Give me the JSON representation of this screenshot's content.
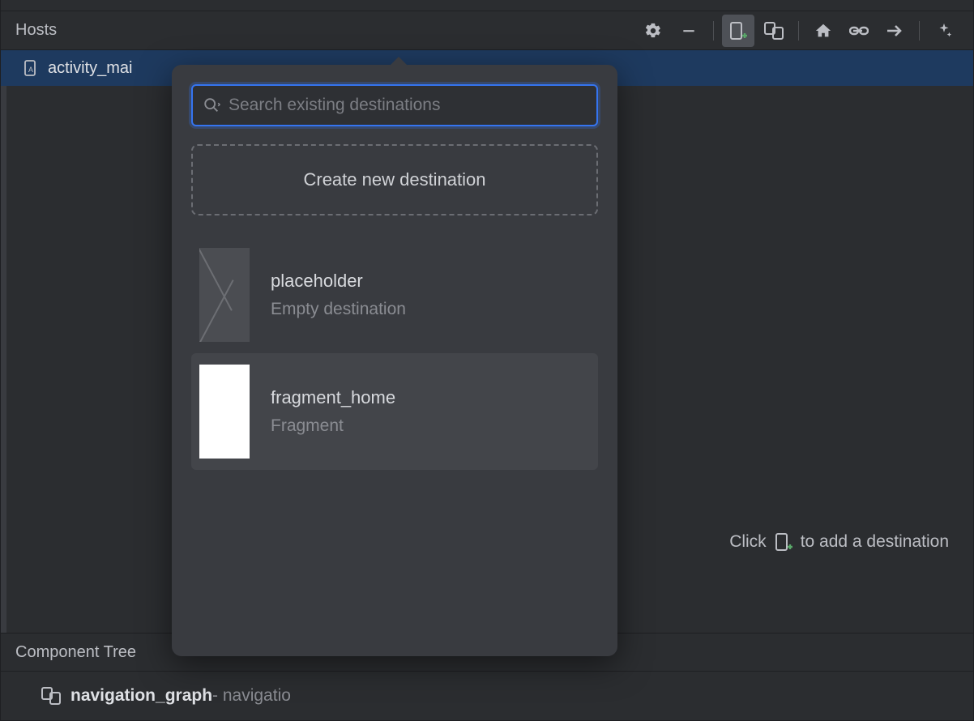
{
  "header": {
    "title": "Hosts"
  },
  "hosts": {
    "active_label": "activity_mai"
  },
  "hint": {
    "before": "Click",
    "after": "to add a destination"
  },
  "tree": {
    "header": "Component Tree",
    "item_name": "navigation_graph",
    "item_suffix": " - navigatio"
  },
  "popup": {
    "search_placeholder": "Search existing destinations",
    "create_label": "Create new destination",
    "destinations": [
      {
        "title": "placeholder",
        "subtitle": "Empty destination",
        "thumb": "placeholder",
        "selected": false
      },
      {
        "title": "fragment_home",
        "subtitle": "Fragment",
        "thumb": "white",
        "selected": true
      }
    ]
  }
}
